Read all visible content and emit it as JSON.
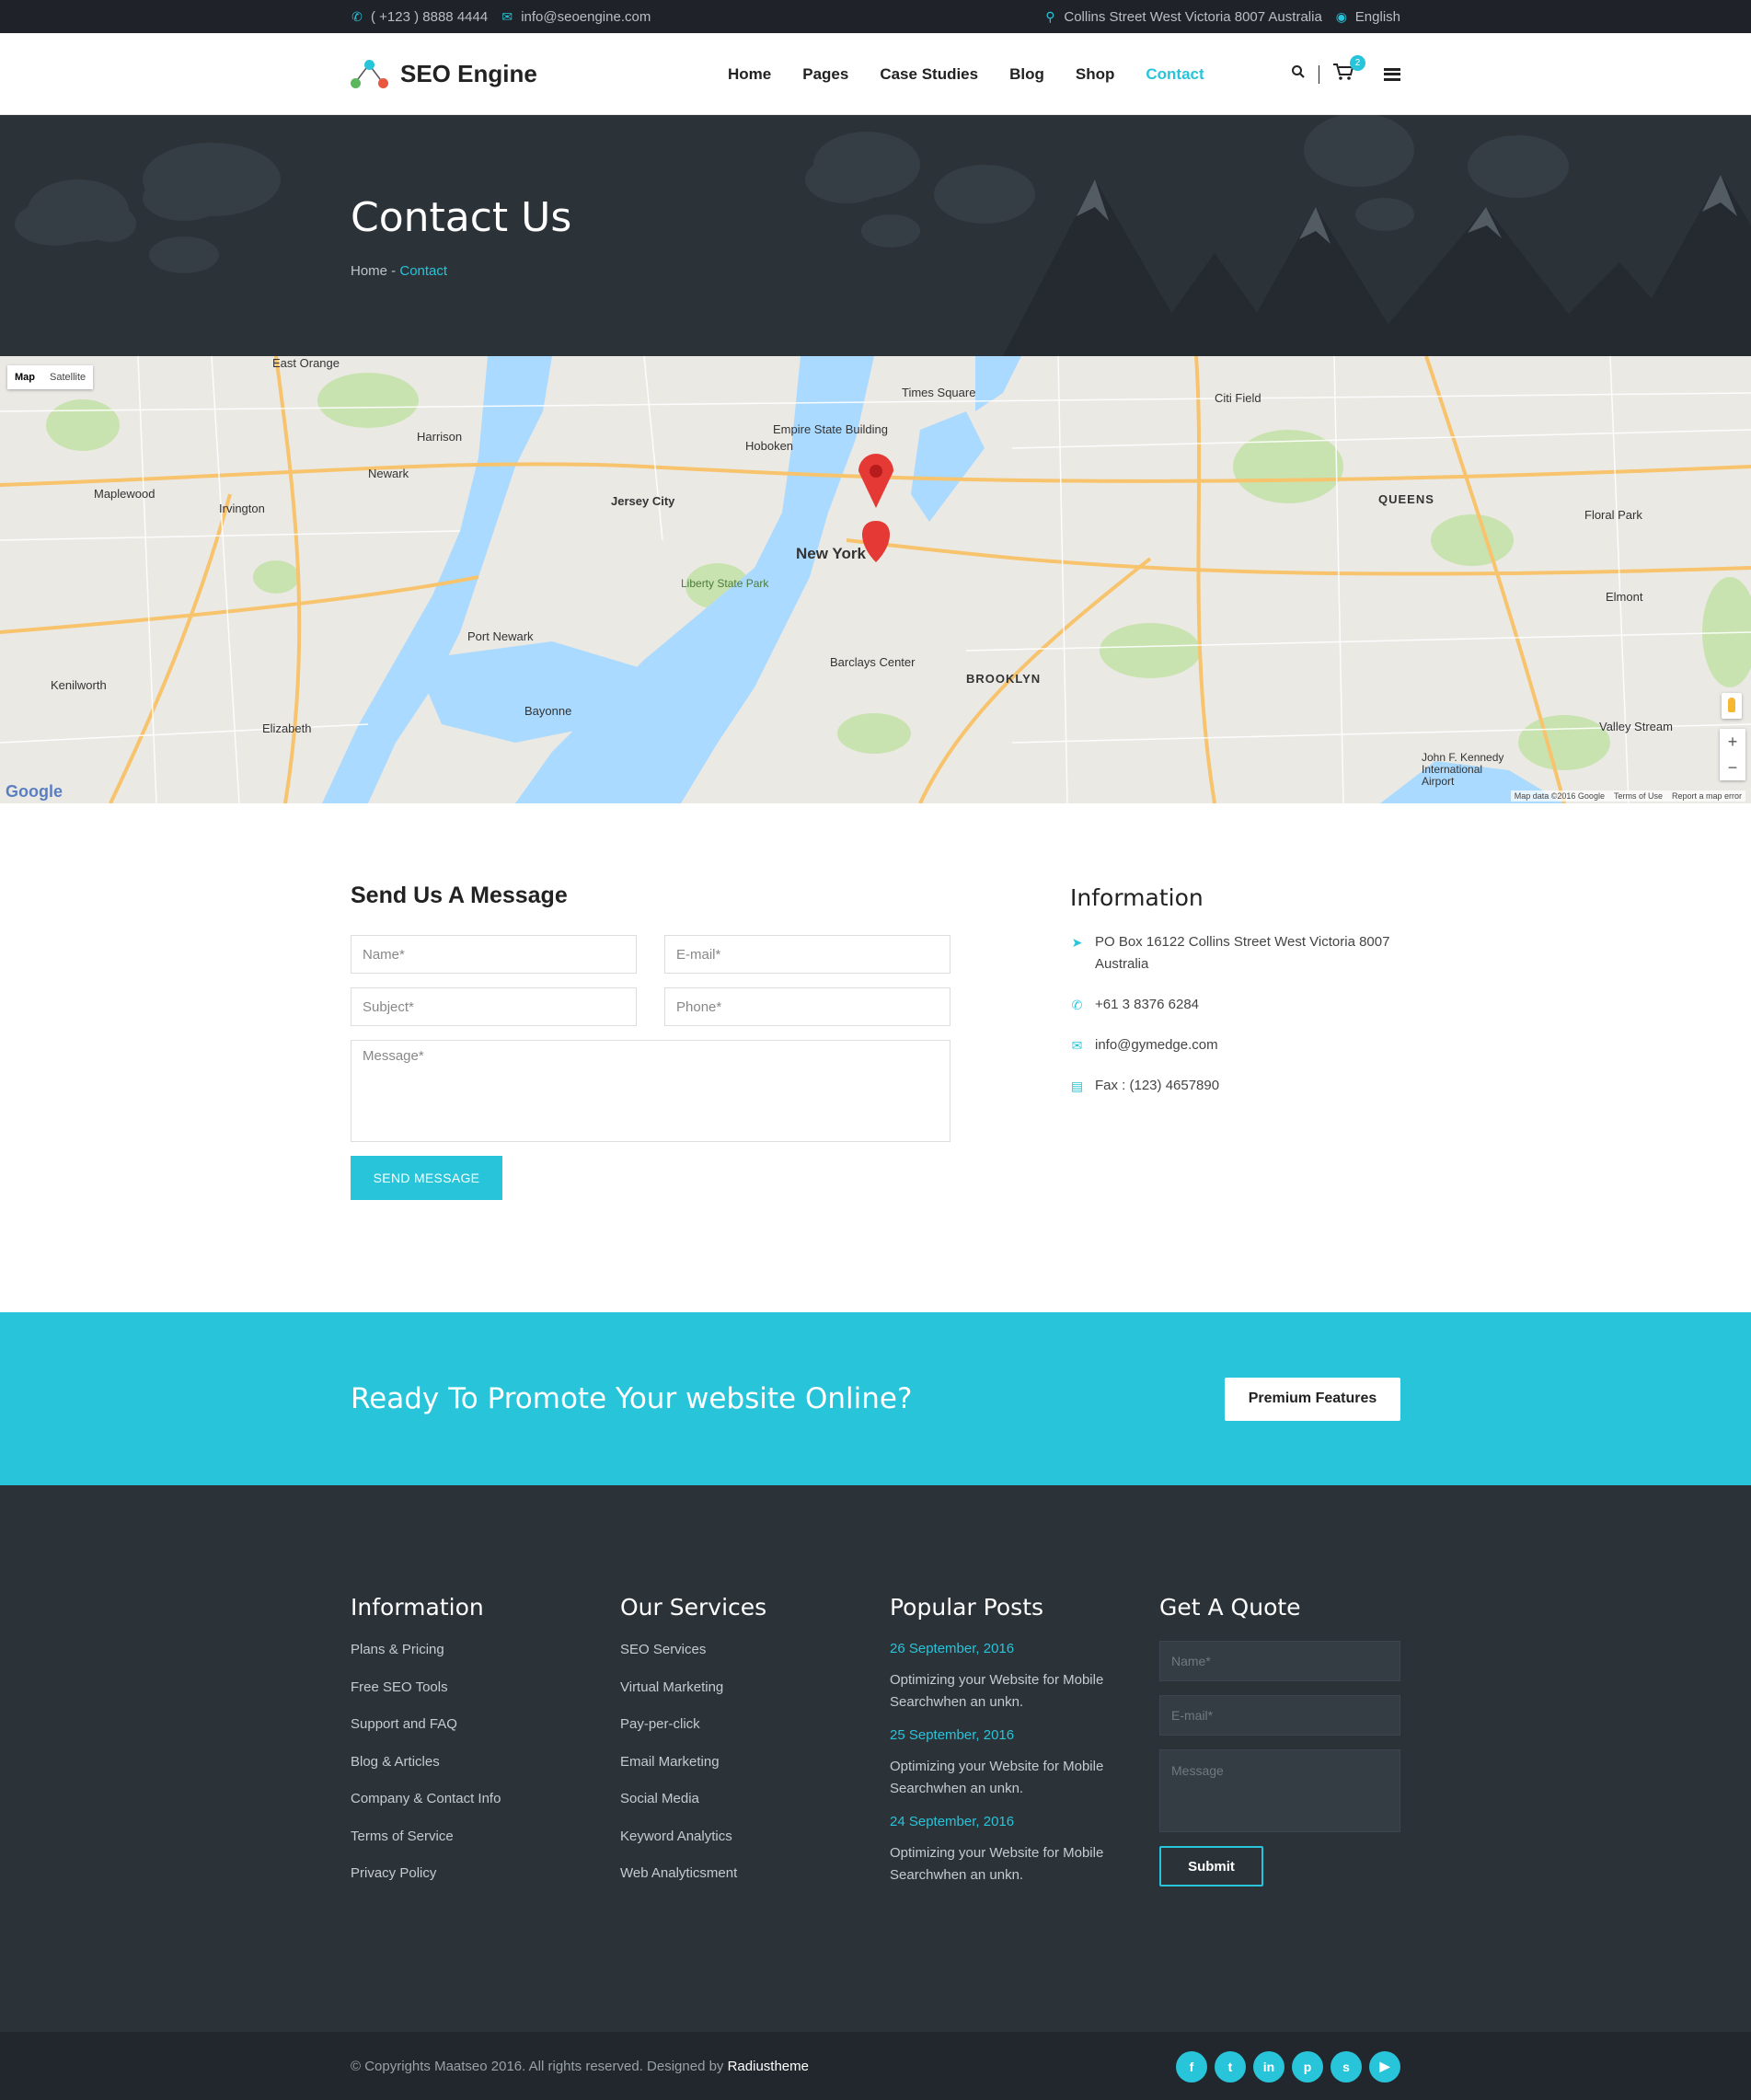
{
  "topbar": {
    "phone": "( +123 ) 8888 4444",
    "email": "info@seoengine.com",
    "address": "Collins Street West Victoria 8007 Australia",
    "language": "English"
  },
  "header": {
    "logo_text": "SEO Engine",
    "nav": [
      {
        "label": "Home",
        "active": false
      },
      {
        "label": "Pages",
        "active": false
      },
      {
        "label": "Case Studies",
        "active": false
      },
      {
        "label": "Blog",
        "active": false
      },
      {
        "label": "Shop",
        "active": false
      },
      {
        "label": "Contact",
        "active": true
      }
    ],
    "cart_count": "2"
  },
  "banner": {
    "title": "Contact Us",
    "breadcrumb_home": "Home",
    "breadcrumb_sep": " - ",
    "breadcrumb_current": "Contact"
  },
  "map": {
    "type_map": "Map",
    "type_satellite": "Satellite",
    "zoom_in": "+",
    "zoom_out": "−",
    "google": "Google",
    "map_data": "Map data ©2016 Google",
    "terms": "Terms of Use",
    "report": "Report a map error",
    "labels": {
      "new_york": "New York",
      "jersey_city": "Jersey City",
      "newark": "Newark",
      "brooklyn": "BROOKLYN",
      "queens": "QUEENS",
      "hoboken": "Hoboken",
      "elizabeth": "Elizabeth",
      "bayonne": "Bayonne",
      "kenilworth": "Kenilworth",
      "port_newark": "Port Newark",
      "irvington": "Irvington",
      "maplewood": "Maplewood",
      "harrison": "Harrison",
      "east_orange": "East Orange",
      "floral_park": "Floral Park",
      "elmont": "Elmont",
      "valley_stream": "Valley Stream",
      "barclays": "Barclays Center",
      "times_square": "Times Square",
      "empire": "Empire State Building",
      "citi_field": "Citi Field",
      "liberty": "Liberty State Park",
      "jfk": "John F. Kennedy International Airport"
    }
  },
  "contact": {
    "form_title": "Send Us A Message",
    "name_placeholder": "Name*",
    "email_placeholder": "E-mail*",
    "subject_placeholder": "Subject*",
    "phone_placeholder": "Phone*",
    "message_placeholder": "Message*",
    "send_label": "SEND MESSAGE",
    "info_title": "Information",
    "address": "PO Box 16122 Collins Street West Victoria 8007 Australia",
    "phone": "+61 3 8376 6284",
    "email": "info@gymedge.com",
    "fax": "Fax : (123) 4657890"
  },
  "promo": {
    "heading": "Ready To Promote Your website Online?",
    "button": "Premium Features"
  },
  "footer": {
    "info_title": "Information",
    "info_links": [
      "Plans & Pricing",
      "Free SEO Tools",
      "Support and FAQ",
      "Blog & Articles",
      "Company & Contact Info",
      "Terms of Service",
      "Privacy Policy"
    ],
    "services_title": "Our Services",
    "services_links": [
      "SEO Services",
      "Virtual Marketing",
      "Pay-per-click",
      "Email Marketing",
      "Social Media",
      "Keyword Analytics",
      "Web Analyticsment"
    ],
    "posts_title": "Popular Posts",
    "posts": [
      {
        "date": "26 September, 2016",
        "title": "Optimizing your Website for Mobile Searchwhen an unkn."
      },
      {
        "date": "25 September, 2016",
        "title": "Optimizing your Website for Mobile Searchwhen an unkn."
      },
      {
        "date": "24 September, 2016",
        "title": "Optimizing your Website for Mobile Searchwhen an unkn."
      }
    ],
    "quote_title": "Get A Quote",
    "quote_name": "Name*",
    "quote_email": "E-mail*",
    "quote_message": "Message",
    "submit": "Submit"
  },
  "bottom": {
    "copyright": "© Copyrights Maatseo 2016. All rights reserved. Designed by ",
    "designer": "Radiustheme",
    "socials": [
      {
        "icon": "facebook-icon",
        "glyph": "f"
      },
      {
        "icon": "twitter-icon",
        "glyph": "t"
      },
      {
        "icon": "linkedin-icon",
        "glyph": "in"
      },
      {
        "icon": "pinterest-icon",
        "glyph": "p"
      },
      {
        "icon": "skype-icon",
        "glyph": "s"
      },
      {
        "icon": "youtube-icon",
        "glyph": "▶"
      }
    ]
  },
  "colors": {
    "accent": "#27c4da",
    "dark": "#2b3238",
    "topbar": "#1f2329"
  }
}
